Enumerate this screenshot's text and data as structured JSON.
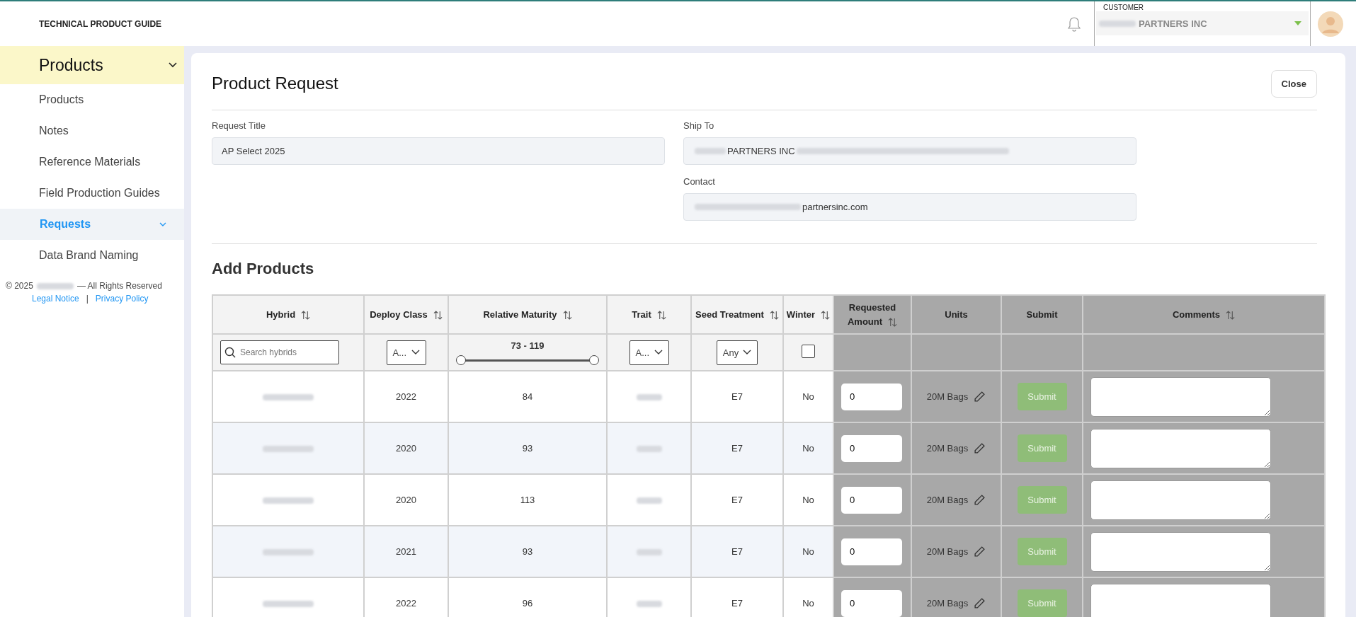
{
  "header": {
    "title": "TECHNICAL PRODUCT GUIDE",
    "customer": {
      "label": "CUSTOMER",
      "value": "PARTNERS INC"
    }
  },
  "sidebar": {
    "section": "Products",
    "items": [
      {
        "label": "Products",
        "selected": false,
        "expandable": false
      },
      {
        "label": "Notes",
        "selected": false,
        "expandable": false
      },
      {
        "label": "Reference Materials",
        "selected": false,
        "expandable": false
      },
      {
        "label": "Field Production Guides",
        "selected": false,
        "expandable": false
      },
      {
        "label": "Requests",
        "selected": true,
        "expandable": true
      },
      {
        "label": "Data Brand Naming",
        "selected": false,
        "expandable": false
      }
    ],
    "footer": {
      "copyright_start": "© 2025",
      "copyright_end": "— All Rights Reserved",
      "links": [
        "Legal Notice",
        "Privacy Policy"
      ],
      "separator": "|"
    }
  },
  "form": {
    "title": "Product Request",
    "close_button": "Close",
    "request_title": {
      "label": "Request Title",
      "value": "AP Select 2025"
    },
    "ship_to": {
      "label": "Ship To",
      "value": "PARTNERS INC"
    },
    "contact": {
      "label": "Contact",
      "value": "partnersinc.com"
    }
  },
  "products": {
    "title": "Add Products",
    "columns": [
      {
        "label": "Hybrid",
        "sortable": true,
        "kind": "data",
        "filter": {
          "kind": "search",
          "placeholder": "Search hybrids"
        }
      },
      {
        "label": "Deploy Class",
        "sortable": true,
        "kind": "data",
        "filter": {
          "kind": "select",
          "value": "A..."
        }
      },
      {
        "label": "Relative Maturity",
        "sortable": true,
        "kind": "data",
        "filter": {
          "kind": "range",
          "value": "73 - 119",
          "level": 1
        }
      },
      {
        "label": "Trait",
        "sortable": true,
        "kind": "data",
        "filter": {
          "kind": "select",
          "value": "A..."
        }
      },
      {
        "label": "Seed Treatment",
        "sortable": true,
        "kind": "data",
        "filter": {
          "kind": "select",
          "value": "Any"
        }
      },
      {
        "label": "Winter",
        "sortable": true,
        "kind": "data",
        "filter": {
          "kind": "checkbox",
          "checked": false
        }
      },
      {
        "label": "Requested Amount",
        "sortable": true,
        "kind": "entry"
      },
      {
        "label": "Units",
        "sortable": false,
        "kind": "entry"
      },
      {
        "label": "Submit",
        "sortable": false,
        "kind": "entry"
      },
      {
        "label": "Comments",
        "sortable": true,
        "kind": "entry"
      }
    ],
    "rows": [
      {
        "deploy_class": "2022",
        "relative_maturity": "84",
        "seed_treatment": "E7",
        "winter": "No",
        "amount": "0",
        "units": "20M Bags",
        "submit": "Submit"
      },
      {
        "deploy_class": "2020",
        "relative_maturity": "93",
        "seed_treatment": "E7",
        "winter": "No",
        "amount": "0",
        "units": "20M Bags",
        "submit": "Submit"
      },
      {
        "deploy_class": "2020",
        "relative_maturity": "113",
        "seed_treatment": "E7",
        "winter": "No",
        "amount": "0",
        "units": "20M Bags",
        "submit": "Submit"
      },
      {
        "deploy_class": "2021",
        "relative_maturity": "93",
        "seed_treatment": "E7",
        "winter": "No",
        "amount": "0",
        "units": "20M Bags",
        "submit": "Submit"
      },
      {
        "deploy_class": "2022",
        "relative_maturity": "96",
        "seed_treatment": "E7",
        "winter": "No",
        "amount": "0",
        "units": "20M Bags",
        "submit": "Submit"
      }
    ]
  }
}
